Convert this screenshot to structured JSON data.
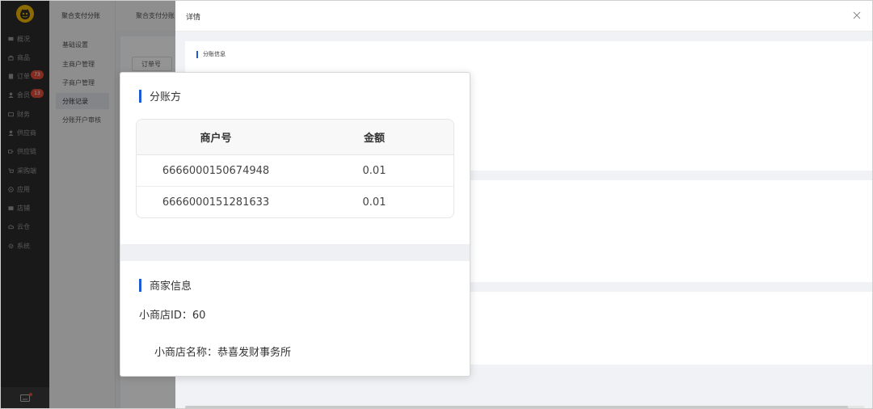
{
  "nav": {
    "items": [
      {
        "label": "概况",
        "icon": "monitor-icon"
      },
      {
        "label": "商品",
        "icon": "bag-icon"
      },
      {
        "label": "订单",
        "icon": "doc-icon",
        "badge": "73"
      },
      {
        "label": "会员",
        "icon": "user-icon",
        "badge": "13"
      },
      {
        "label": "财务",
        "icon": "wallet-icon"
      },
      {
        "label": "供应商",
        "icon": "user-icon"
      },
      {
        "label": "供应链",
        "icon": "link-icon"
      },
      {
        "label": "采购端",
        "icon": "cart-icon"
      },
      {
        "label": "应用",
        "icon": "grid-icon"
      },
      {
        "label": "店铺",
        "icon": "shop-icon"
      },
      {
        "label": "云仓",
        "icon": "cloud-icon"
      },
      {
        "label": "系统",
        "icon": "gear-icon"
      }
    ]
  },
  "submenu": {
    "title": "聚合支付分账",
    "items": [
      {
        "label": "基础设置",
        "active": false
      },
      {
        "label": "主商户管理",
        "active": false
      },
      {
        "label": "子商户管理",
        "active": false
      },
      {
        "label": "分账记录",
        "active": true
      },
      {
        "label": "分账开户审核",
        "active": false
      }
    ]
  },
  "background": {
    "tab": "聚合支付分账",
    "field": "订单号"
  },
  "drawer": {
    "title": "详情",
    "card_title": "分账信息"
  },
  "popover": {
    "split_section_title": "分账方",
    "table_headers": [
      "商户号",
      "金额"
    ],
    "rows": [
      {
        "merchant": "6666000150674948",
        "amount": "0.01"
      },
      {
        "merchant": "6666000151281633",
        "amount": "0.01"
      }
    ],
    "merchant_section_title": "商家信息",
    "shop_id_line": "小商店ID：60",
    "shop_name_line": "小商店名称：恭喜发财事务所"
  },
  "colors": {
    "accent": "#1f5bd9",
    "nav_bg": "#2b2b2b",
    "badge": "#e44d3a",
    "logo": "#f2b705"
  }
}
